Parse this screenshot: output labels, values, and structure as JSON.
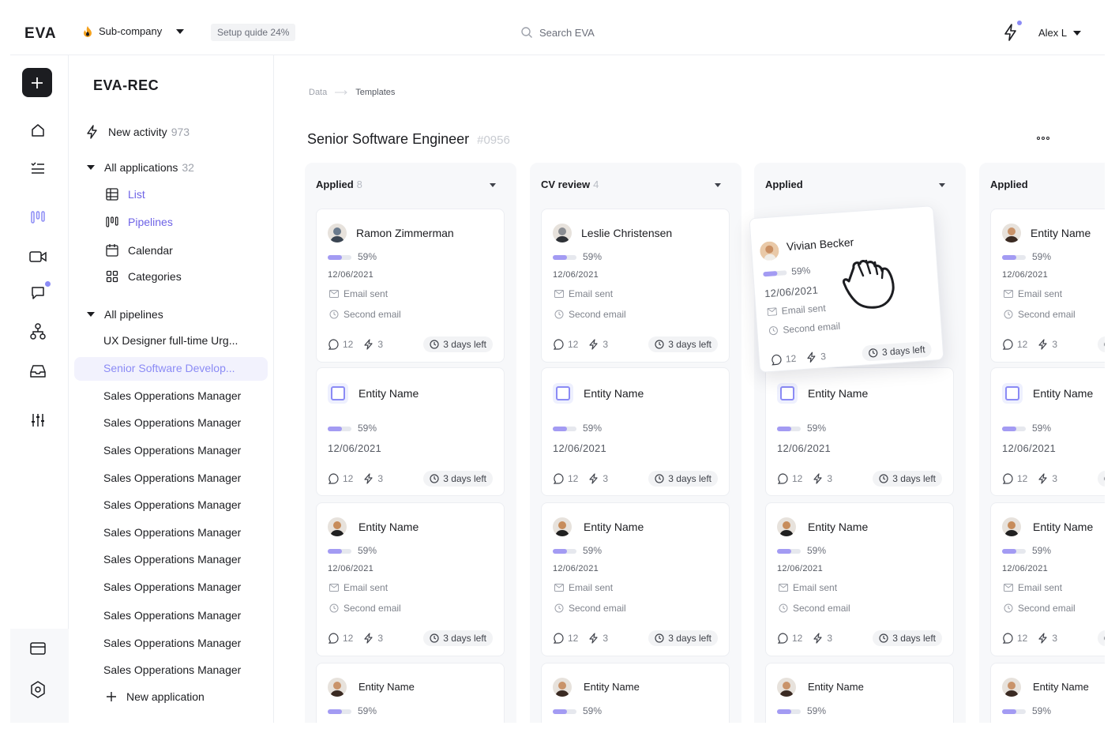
{
  "topbar": {
    "logo": "EVA",
    "company": "Sub-company",
    "setup_guide": "Setup quide 24%",
    "search_placeholder": "Search EVA",
    "user": "Alex L"
  },
  "sidebar": {
    "title": "EVA-REC",
    "new_activity": {
      "label": "New activity",
      "count": "973"
    },
    "all_applications": {
      "label": "All applications",
      "count": "32"
    },
    "views": [
      {
        "label": "List",
        "active": true
      },
      {
        "label": "Pipelines",
        "active": true
      },
      {
        "label": "Calendar"
      },
      {
        "label": "Categories"
      }
    ],
    "all_pipelines": "All pipelines",
    "pipelines": [
      "UX Designer full-time Urg...",
      "Senior Software Develop...",
      "Sales Opperations Manager",
      "Sales Opperations Manager",
      "Sales Opperations Manager",
      "Sales Opperations Manager",
      "Sales Opperations Manager",
      "Sales Opperations Manager",
      "Sales Opperations Manager",
      "Sales Opperations Manager",
      "Sales Opperations Manager",
      "Sales Opperations Manager",
      "Sales Opperations Manager"
    ],
    "new_application": "New application"
  },
  "main": {
    "breadcrumb": [
      "Data",
      "Templates"
    ],
    "job_title": "Senior Software Engineer",
    "job_id": "#0956",
    "columns": [
      {
        "title": "Applied",
        "count": "8"
      },
      {
        "title": "CV review",
        "count": "4"
      },
      {
        "title": "Applied",
        "count": ""
      },
      {
        "title": "Applied",
        "count": ""
      }
    ],
    "first_cards": [
      "Ramon Zimmerman",
      "Leslie Christensen",
      "",
      "Entity Name"
    ],
    "dragged_card": {
      "name": "Vivian Becker",
      "pct": "59%",
      "date": "12/06/2021",
      "email": "Email sent",
      "second": "Second email",
      "comments": "12",
      "activity": "3",
      "due": "3 days left"
    },
    "card": {
      "entity": "Entity Name",
      "pct": "59%",
      "progress": 0.59,
      "date": "12/06/2021",
      "email": "Email sent",
      "second": "Second email",
      "comments": "12",
      "activity": "3",
      "due": "3 days left"
    }
  },
  "colors": {
    "accent": "#8b8bf5",
    "progress": "#a39bf3",
    "dark": "#1c1d21"
  }
}
